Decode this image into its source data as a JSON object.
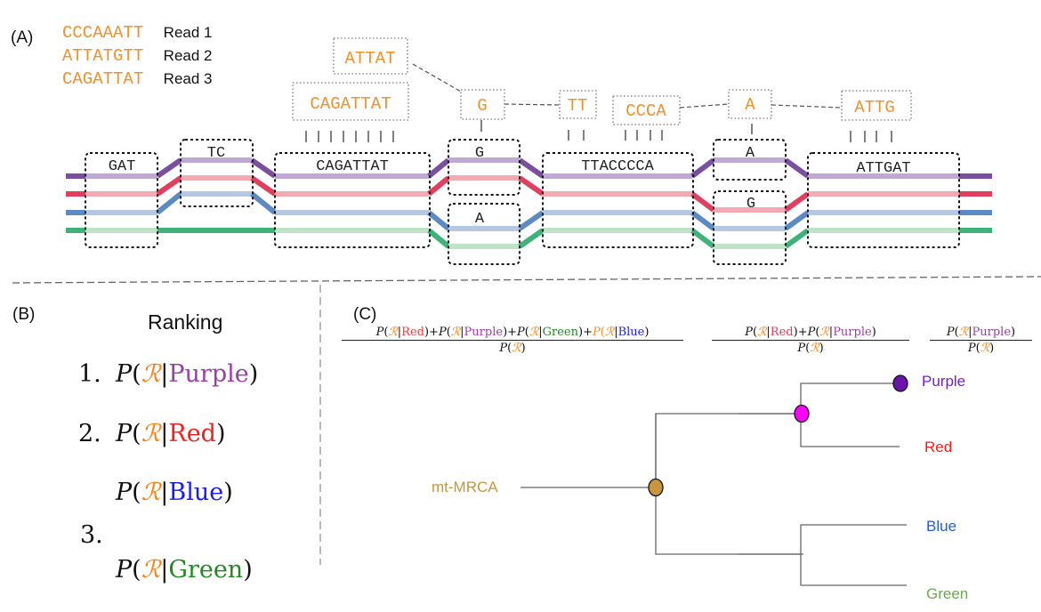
{
  "panel_a": {
    "label": "(A)",
    "reads": [
      {
        "sequence": "CCCAAATT",
        "name": "Read 1"
      },
      {
        "sequence": "ATTATGTT",
        "name": "Read 2"
      },
      {
        "sequence": "CAGATTAT",
        "name": "Read 3"
      }
    ],
    "graph_nodes": [
      "GAT",
      "TC",
      "CAGATTAT",
      "G",
      "A",
      "TTACCCCA",
      "A",
      "G",
      "ATTGAT"
    ],
    "aligned_fragments": [
      "ATTAT",
      "CAGATTAT",
      "G",
      "TT",
      "CCCA",
      "A",
      "ATTG"
    ],
    "path_colors": {
      "purple": "#7b4fa0",
      "red": "#e0405e",
      "blue": "#5b8ac4",
      "green": "#3db37a"
    }
  },
  "panel_b": {
    "label": "(B)",
    "title": "Ranking",
    "rank_numbers": [
      "1.",
      "2.",
      "3."
    ],
    "entries": [
      {
        "P": "P(",
        "R": "R",
        "bar": "|",
        "haplo": "Purple",
        "close": ")",
        "color": "#9b3fa8"
      },
      {
        "P": "P(",
        "R": "R",
        "bar": "|",
        "haplo": "Red",
        "close": ")",
        "color": "#ff1a1a"
      },
      {
        "P": "P(",
        "R": "R",
        "bar": "|",
        "haplo": "Blue",
        "close": ")",
        "color": "#1a1aff"
      },
      {
        "P": "P(",
        "R": "R",
        "bar": "|",
        "haplo": "Green",
        "close": ")",
        "color": "#218a21"
      }
    ]
  },
  "panel_c": {
    "label": "(C)",
    "formulas": [
      {
        "numerator_terms": [
          "Red",
          "Purple",
          "Green",
          "Blue"
        ],
        "denominator": "P(R)"
      },
      {
        "numerator_terms": [
          "Red",
          "Purple"
        ],
        "denominator": "P(R)"
      },
      {
        "numerator_terms": [
          "Purple"
        ],
        "denominator": "P(R)"
      }
    ],
    "tree": {
      "root": "mt-MRCA",
      "leaves": [
        "Purple",
        "Red",
        "Blue",
        "Green"
      ],
      "colors": {
        "root": "#c8963c",
        "Purple": "#7a1fc8",
        "Red": "#ff1a1a",
        "Blue": "#1f5fd6",
        "Green": "#6aa84f",
        "node_root": "#c8963c",
        "node_pr": "#ff00ff",
        "node_purple": "#6a14b0"
      }
    }
  },
  "math": {
    "P": "P",
    "R": "R",
    "open": "(",
    "close": ")",
    "bar": "|",
    "plus": "+"
  }
}
